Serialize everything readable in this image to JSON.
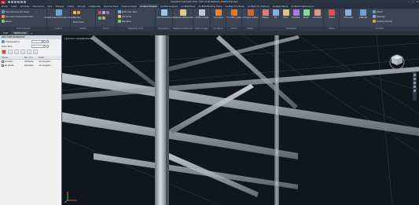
{
  "titlebar": {
    "app_icon": "A",
    "title": "Autodesk AutoCAD 2019 - NOT FOR RESALE   TEMPLATE.dwg",
    "minimize": "–",
    "maximize": "□",
    "close": "✕"
  },
  "ribbon_tabs": [
    "Home",
    "Insert",
    "Annotate",
    "Parametric",
    "View",
    "Manage",
    "Output",
    "Add-ins",
    "Collaborate",
    "Express Tools",
    "Featured Apps",
    "As-Built Modeler",
    "As-Built Analysis",
    "As-Built Plant",
    "As-Built Building Plans",
    "As-Built TS (Steel)",
    "As-Built TS (Carbon)",
    "As-Built Plants",
    "As-Built Feature Extrn"
  ],
  "active_tab_index": 11,
  "ribbon": {
    "point_clouds": {
      "label": "Point Clouds",
      "row1": "Set current point cloud",
      "row2": "Set point cloud parameters",
      "row3": "Reset"
    },
    "import": {
      "label": "Import",
      "big_button": "Create AutoCAD point cloud"
    },
    "dialog": {
      "label": "Dialog",
      "row1": "Section",
      "row2": "Point Sets"
    },
    "lines": {
      "label": "Lines"
    },
    "digitizing": {
      "label": "Digitizing tools",
      "row1": "ECS from disc",
      "row2": "3D Circle",
      "row3": "Elevation"
    },
    "dimension": {
      "label": "Dimension",
      "big_button": "3D Dimension"
    },
    "measure": {
      "label": "Measure differences",
      "big_button": "Measure differences"
    },
    "ortho": {
      "label": "Ortho Image",
      "big_button": "Ortho image"
    },
    "fit_plane": {
      "label": "Fit Plane",
      "big_button": "Fit plane"
    },
    "pt_plane": {
      "label": "Plane",
      "big_button": "Pt within plane"
    },
    "polygon": {
      "label": "Plane",
      "big_button": "Polygon plane"
    },
    "modeling": {
      "label": "Modeling",
      "b1": "Planar",
      "b2": "Fit",
      "b3": "Pipe",
      "b4": "Surface",
      "b5": "Mesh",
      "b6": "Intersect"
    },
    "close": {
      "label": "Close",
      "big_button": "Close"
    },
    "as_built": {
      "label": "As-Built",
      "b1": "3D mode",
      "b2": "Manual",
      "r1": "About",
      "r2": "Settings",
      "r3": "Getting Started"
    }
  },
  "file_tabs": [
    {
      "label": "Start"
    },
    {
      "label": "TEMPLATE*"
    }
  ],
  "left_panel": {
    "header": "SECTION MANAGER",
    "transparency_label": "Transparency",
    "transparency_value": "80",
    "pointsize_label": "Point Size",
    "pointsize_value": "1",
    "columns": {
      "name": "Name",
      "points": "No. of p...",
      "color": "Color"
    },
    "rows": [
      {
        "name": "Current",
        "points": "unknown",
        "color": "not support..."
      },
      {
        "name": "all points",
        "points": "unknown",
        "color": "not support..."
      }
    ]
  },
  "viewport": {
    "label": "[-][Custom View][Realistic]"
  },
  "viewcube": {
    "top": "TOP",
    "compass_n": "N",
    "compass_s": "S",
    "compass_e": "E",
    "compass_w": "W"
  },
  "ucs": {
    "x": "X",
    "y": "Y",
    "z": "Z"
  },
  "colors": {
    "accent": "#c8312e",
    "ribbon_bg": "#3b4553",
    "viewport_bg": "#11151c",
    "steel": "#c8cdd4"
  }
}
